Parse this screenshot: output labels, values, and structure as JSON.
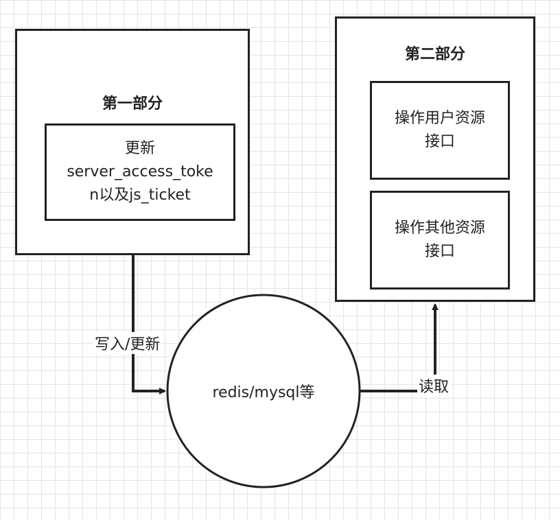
{
  "part_one": {
    "title": "第一部分",
    "node": {
      "line1": "更新",
      "line2": "server_access_toke",
      "line3": "n以及js_ticket"
    }
  },
  "part_two": {
    "title": "第二部分",
    "node_user": {
      "line1": "操作用户资源",
      "line2": "接口"
    },
    "node_other": {
      "line1": "操作其他资源",
      "line2": "接口"
    }
  },
  "storage": {
    "label": "redis/mysql等"
  },
  "edges": {
    "write": "写入/更新",
    "read": "读取"
  }
}
